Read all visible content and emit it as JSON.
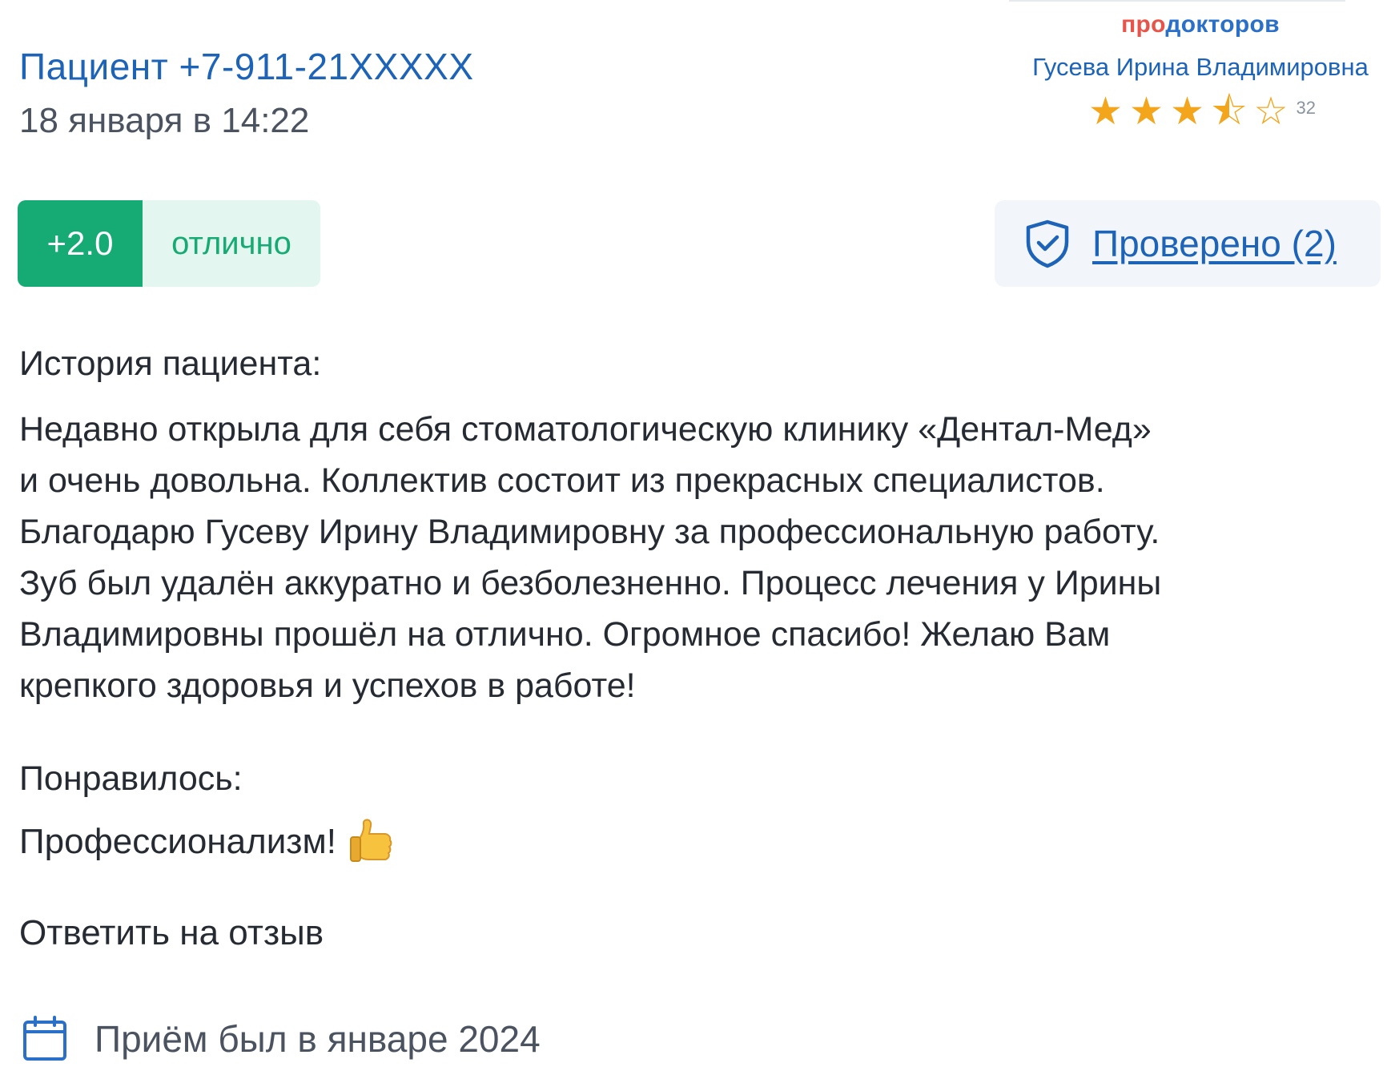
{
  "review": {
    "author": "Пациент +7-911-21XXXXX",
    "date": "18 января в 14:22",
    "score": "+2.0",
    "score_label": "отлично",
    "verified_label": "Проверено (2)",
    "story_title": "История пациента:",
    "story_lines": [
      "Недавно открыла для себя стоматологическую клинику «Дентал-Мед»",
      "и очень довольна. Коллектив состоит из прекрасных специалистов.",
      "Благодарю Гусеву Ирину Владимировну за профессиональную работу.",
      "Зуб был удалён аккуратно и безболезненно. Процесс лечения у Ирины",
      "Владимировны прошёл на отлично. Огромное спасибо! Желаю Вам",
      "крепкого здоровья и успехов в работе!"
    ],
    "liked_title": "Понравилось:",
    "liked_text": "Профессионализм!",
    "liked_emoji": "thumbs-up-icon",
    "reply_label": "Ответить на отзыв",
    "visit_text": "Приём был в январе 2024"
  },
  "brand": {
    "logo_part_a": "про",
    "logo_part_b": "докторов",
    "doctor_name": "Гусева Ирина Владимировна",
    "rating_stars": 3.5,
    "rating_count": "32"
  },
  "colors": {
    "link_blue": "#1d63b8",
    "score_green": "#16aa74",
    "score_bg": "#e3f6ef",
    "star_orange": "#f3a51b",
    "verified_bg": "#f2f6fb",
    "brand_red": "#e8534a"
  }
}
